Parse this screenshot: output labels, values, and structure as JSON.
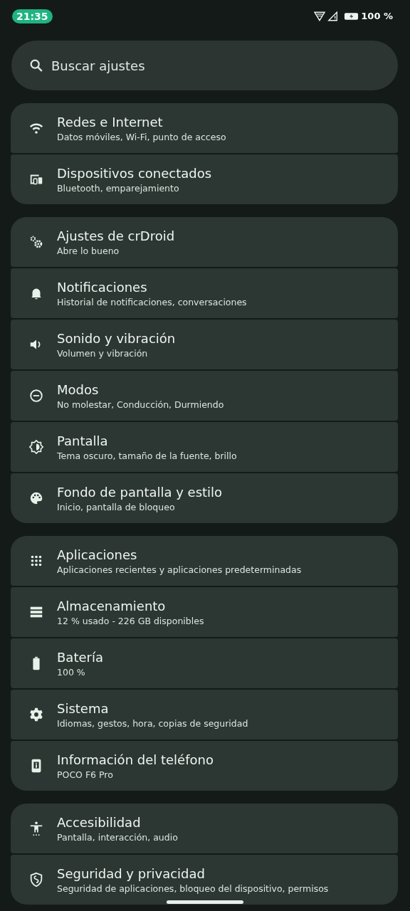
{
  "status_bar": {
    "time": "21:35",
    "battery": "100 %"
  },
  "search": {
    "placeholder": "Buscar ajustes"
  },
  "groups": [
    {
      "items": [
        {
          "title": "Redes e Internet",
          "subtitle": "Datos móviles, Wi-Fi, punto de acceso"
        },
        {
          "title": "Dispositivos conectados",
          "subtitle": "Bluetooth, emparejamiento"
        }
      ]
    },
    {
      "items": [
        {
          "title": "Ajustes de crDroid",
          "subtitle": "Abre lo bueno"
        },
        {
          "title": "Notificaciones",
          "subtitle": "Historial de notificaciones, conversaciones"
        },
        {
          "title": "Sonido y vibración",
          "subtitle": "Volumen y vibración"
        },
        {
          "title": "Modos",
          "subtitle": "No molestar, Conducción, Durmiendo"
        },
        {
          "title": "Pantalla",
          "subtitle": "Tema oscuro, tamaño de la fuente, brillo"
        },
        {
          "title": "Fondo de pantalla y estilo",
          "subtitle": "Inicio, pantalla de bloqueo"
        }
      ]
    },
    {
      "items": [
        {
          "title": "Aplicaciones",
          "subtitle": "Aplicaciones recientes y aplicaciones predeterminadas"
        },
        {
          "title": "Almacenamiento",
          "subtitle": "12 % usado - 226 GB disponibles"
        },
        {
          "title": "Batería",
          "subtitle": "100 %"
        },
        {
          "title": "Sistema",
          "subtitle": "Idiomas, gestos, hora, copias de seguridad"
        },
        {
          "title": "Información del teléfono",
          "subtitle": "POCO F6 Pro"
        }
      ]
    },
    {
      "items": [
        {
          "title": "Accesibilidad",
          "subtitle": "Pantalla, interacción, audio"
        },
        {
          "title": "Seguridad y privacidad",
          "subtitle": "Seguridad de aplicaciones, bloqueo del dispositivo, permisos"
        }
      ]
    }
  ]
}
